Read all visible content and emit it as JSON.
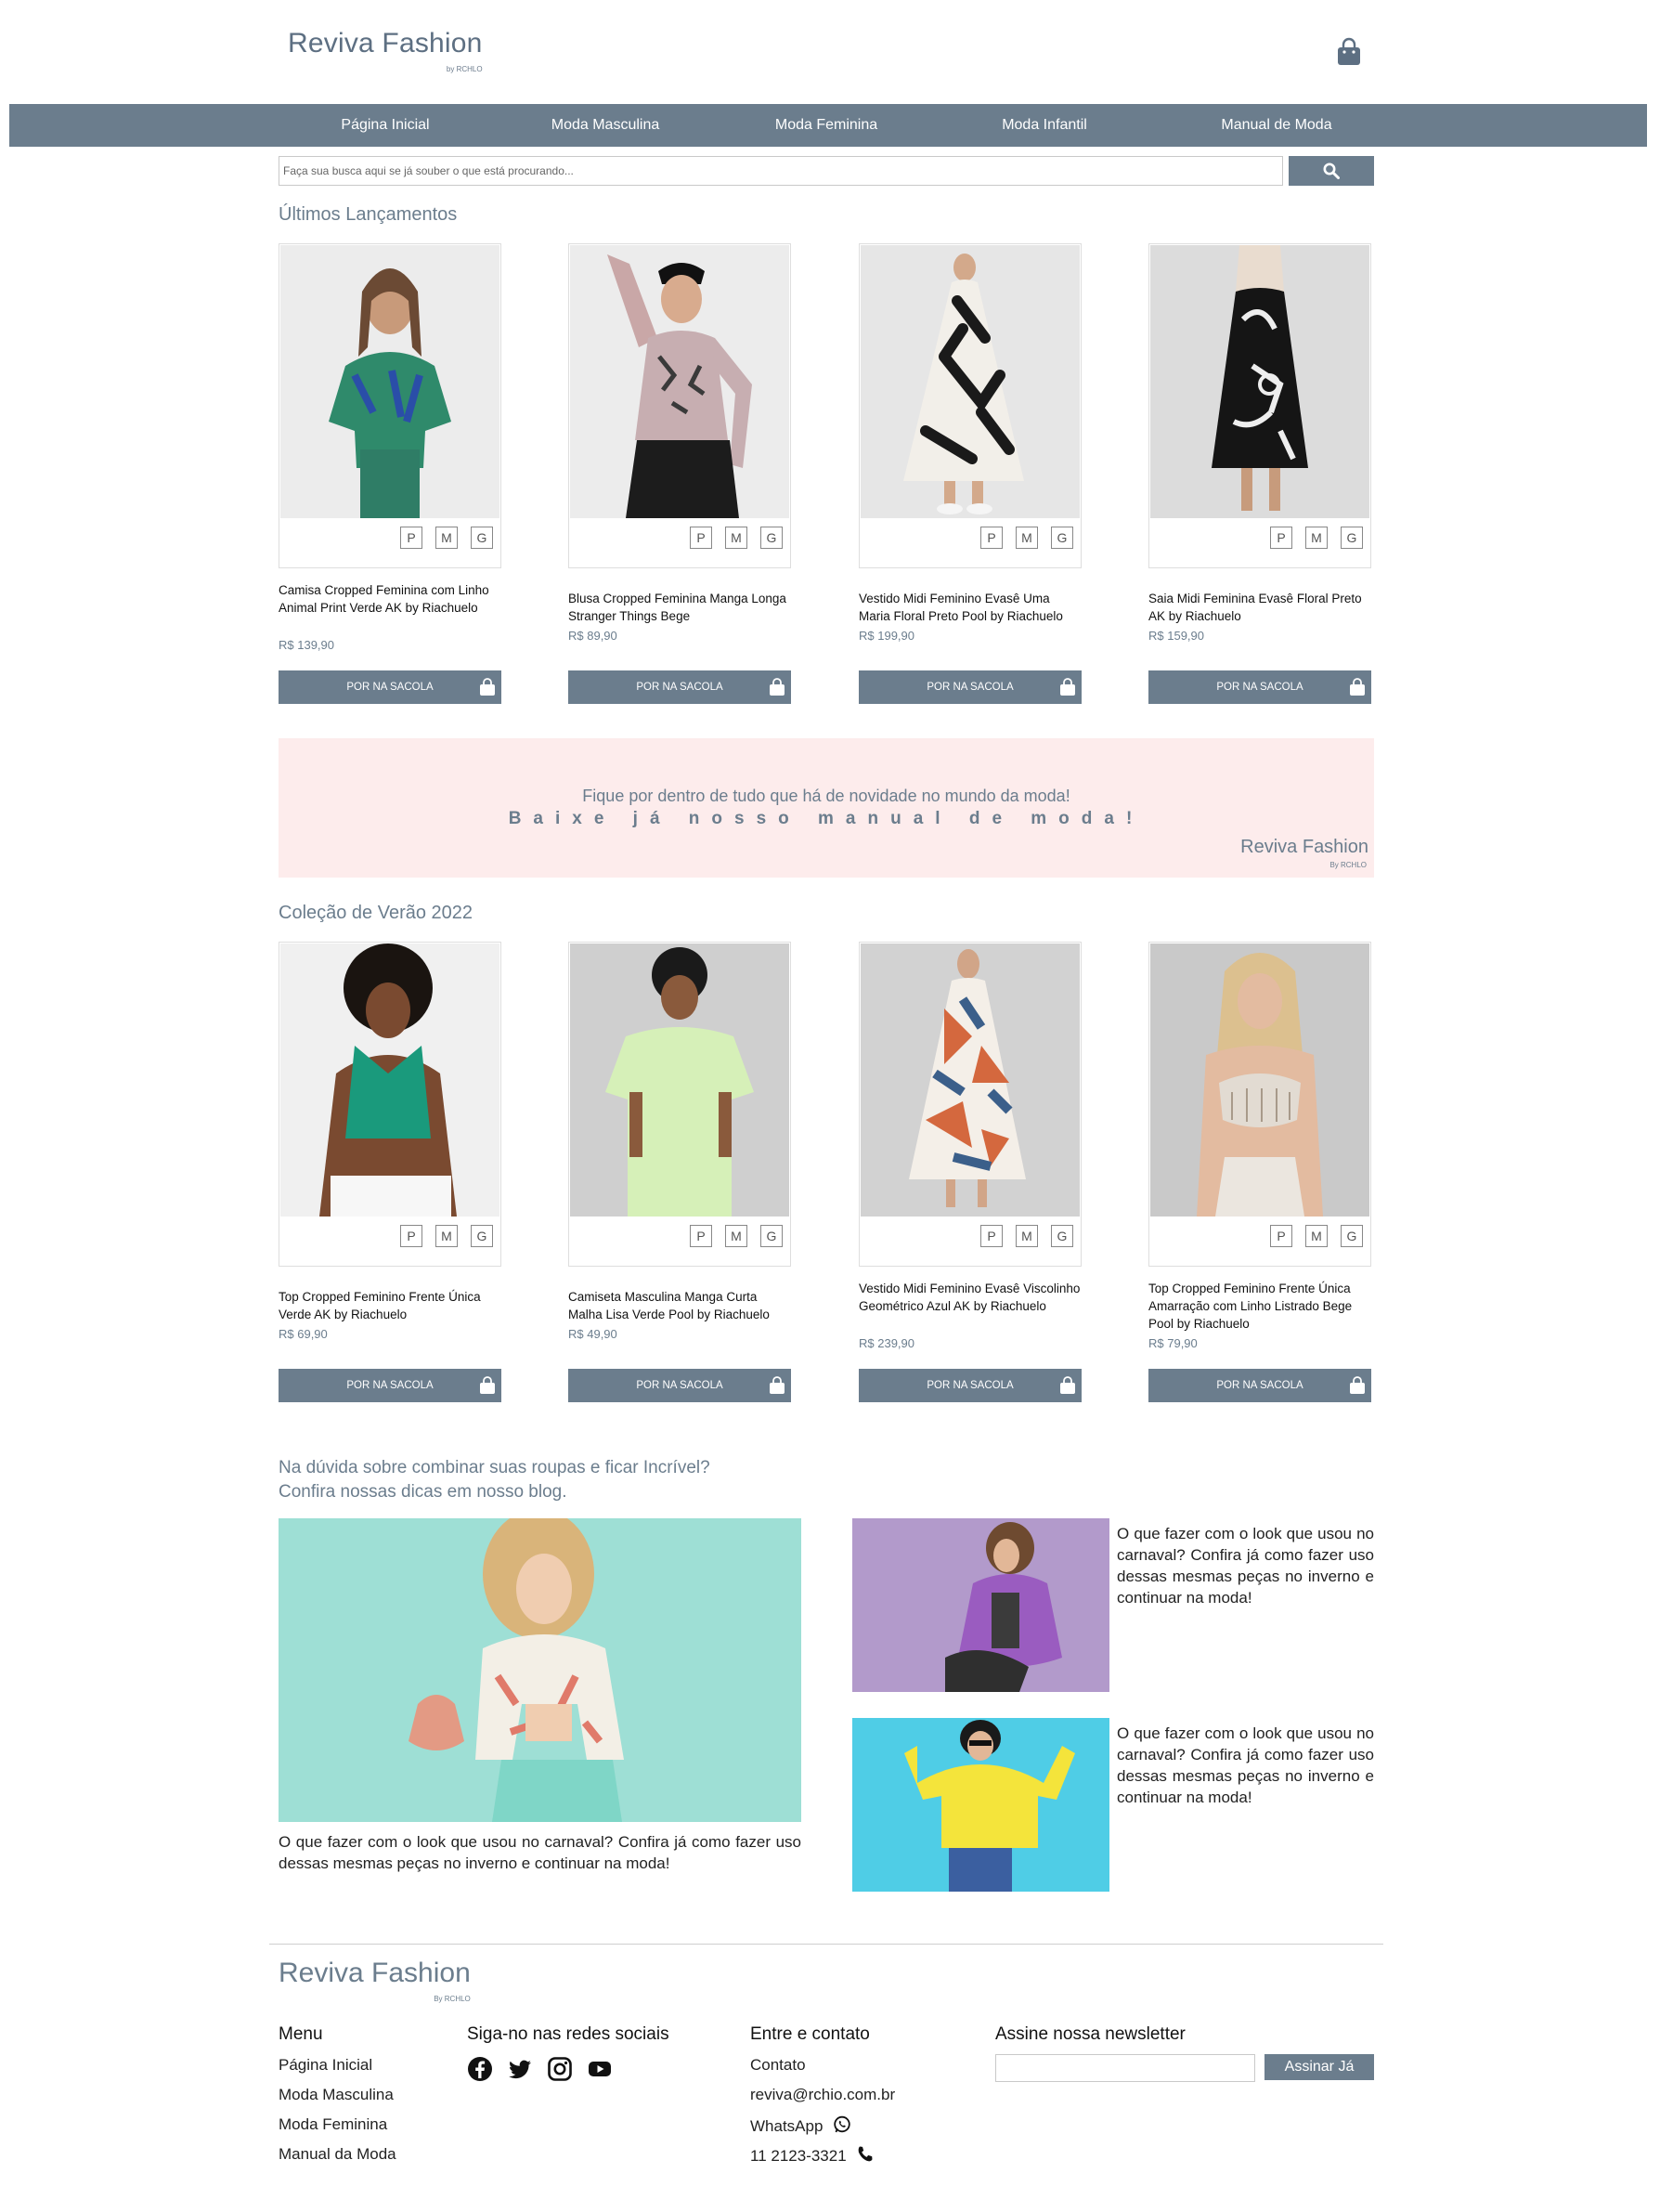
{
  "header": {
    "logo": "Reviva Fashion",
    "logo_sub": "by RCHLO"
  },
  "nav": {
    "items": [
      {
        "label": "Página Inicial"
      },
      {
        "label": "Moda Masculina"
      },
      {
        "label": "Moda Feminina"
      },
      {
        "label": "Moda Infantil"
      },
      {
        "label": "Manual de Moda"
      }
    ]
  },
  "search": {
    "placeholder": "Faça sua busca aqui se já souber o que está procurando..."
  },
  "sections": {
    "launches_title": "Últimos Lançamentos",
    "summer_title": "Coleção de Verão 2022"
  },
  "products_launches": [
    {
      "name": "Camisa Cropped Feminina com Linho Animal Print Verde AK by Riachuelo",
      "price": "R$ 139,90",
      "sizes": [
        "P",
        "M",
        "G"
      ],
      "button": "POR NA SACOLA"
    },
    {
      "name": "Blusa Cropped Feminina Manga Longa Stranger Things Bege",
      "price": "R$ 89,90",
      "sizes": [
        "P",
        "M",
        "G"
      ],
      "button": "POR NA SACOLA"
    },
    {
      "name": "Vestido Midi Feminino Evasê Uma Maria Floral Preto Pool by Riachuelo",
      "price": "R$ 199,90",
      "sizes": [
        "P",
        "M",
        "G"
      ],
      "button": "POR NA SACOLA"
    },
    {
      "name": "Saia Midi Feminina Evasê Floral Preto AK by Riachuelo",
      "price": "R$ 159,90",
      "sizes": [
        "P",
        "M",
        "G"
      ],
      "button": "POR NA SACOLA"
    }
  ],
  "products_summer": [
    {
      "name": "Top Cropped Feminino Frente Única Verde AK by Riachuelo",
      "price": "R$ 69,90",
      "sizes": [
        "P",
        "M",
        "G"
      ],
      "button": "POR NA SACOLA"
    },
    {
      "name": "Camiseta Masculina Manga Curta Malha Lisa Verde Pool by Riachuelo",
      "price": "R$ 49,90",
      "sizes": [
        "P",
        "M",
        "G"
      ],
      "button": "POR NA SACOLA"
    },
    {
      "name": "Vestido Midi Feminino Evasê Viscolinho Geométrico Azul AK by Riachuelo",
      "price": "R$ 239,90",
      "sizes": [
        "P",
        "M",
        "G"
      ],
      "button": "POR NA SACOLA"
    },
    {
      "name": "Top Cropped Feminino Frente Única Amarração com Linho Listrado Bege Pool by Riachuelo",
      "price": "R$ 79,90",
      "sizes": [
        "P",
        "M",
        "G"
      ],
      "button": "POR NA SACOLA"
    }
  ],
  "banner": {
    "line1": "Fique por dentro de tudo que há de novidade no mundo da moda!",
    "line2": "Baixe já nosso manual de moda!",
    "logo": "Reviva Fashion",
    "logo_sub": "By RCHLO"
  },
  "blog": {
    "title_line1": "Na dúvida sobre combinar suas roupas e ficar Incrível?",
    "title_line2": "Confira nossas dicas em nosso blog.",
    "main_text": "O que fazer com o look que usou no carnaval? Confira já como fazer uso dessas mesmas peças no inverno e continuar na moda!",
    "side_posts": [
      {
        "text": "O que fazer com o look que usou no carnaval? Confira já como fazer uso dessas mesmas peças no inverno e continuar na moda!"
      },
      {
        "text": "O que fazer com o look que usou no carnaval? Confira já como fazer uso dessas mesmas peças no inverno e continuar na moda!"
      }
    ]
  },
  "footer": {
    "logo": "Reviva Fashion",
    "logo_sub": "By RCHLO",
    "menu_title": "Menu",
    "menu_items": [
      "Página Inicial",
      "Moda Masculina",
      "Moda Feminina",
      "Manual da Moda"
    ],
    "social_title": "Siga-no nas redes sociais",
    "social_icons": [
      "facebook-icon",
      "twitter-icon",
      "instagram-icon",
      "youtube-icon"
    ],
    "contact_title": "Entre e contato",
    "contact_items": [
      "Contato",
      "reviva@rchio.com.br",
      "WhatsApp",
      "11 2123-3321"
    ],
    "newsletter_title": "Assine nossa newsletter",
    "newsletter_button": "Assinar Já"
  },
  "colors": {
    "accent": "#6b7d8d",
    "banner_bg": "#fdecec"
  }
}
